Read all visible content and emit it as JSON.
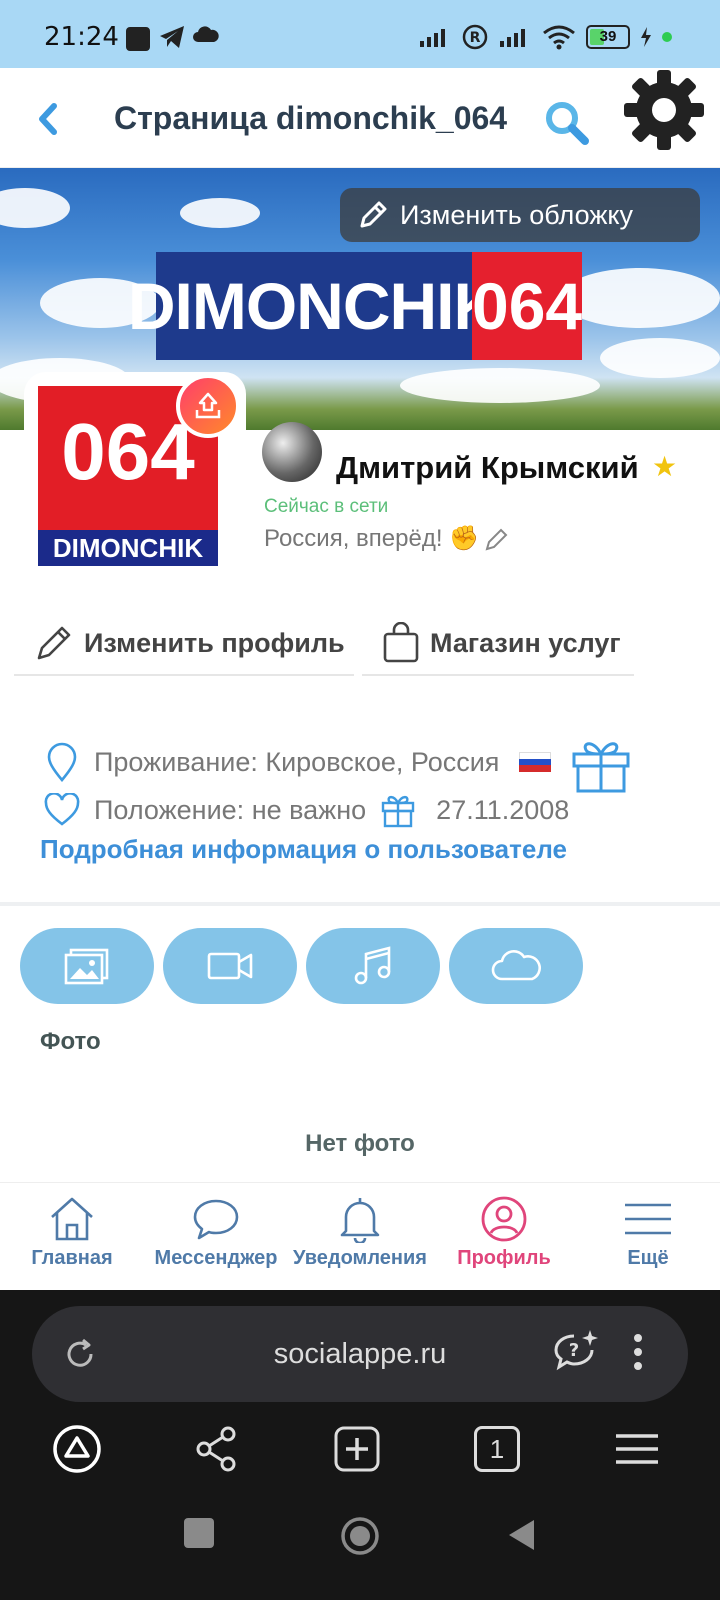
{
  "status_bar": {
    "time": "21:24",
    "battery_level": "39",
    "battery_fraction": 0.39
  },
  "header": {
    "title": "Страница dimonchik_064",
    "back_icon": "chevron-left-icon",
    "search_icon": "search-icon",
    "settings_icon": "gear-icon"
  },
  "cover": {
    "edit_label": "Изменить обложку",
    "banner_left": "DIMONCHIK",
    "banner_right": "064"
  },
  "avatar": {
    "number": "064",
    "label": "DIMONCHIK"
  },
  "user": {
    "name": "Дмитрий Крымский",
    "online": "Сейчас в сети",
    "status": "Россия, вперёд! ✊"
  },
  "actions": {
    "edit_profile": "Изменить профиль",
    "services_shop": "Магазин услуг"
  },
  "info": {
    "residence": "Проживание: Кировское, Россия",
    "position": "Положение: не важно",
    "birthdate": "27.11.2008",
    "more_link": "Подробная информация о пользователе"
  },
  "media": {
    "tabs": [
      "photos-icon",
      "video-icon",
      "music-icon",
      "cloud-icon"
    ],
    "section_label": "Фото",
    "empty_text": "Нет фото"
  },
  "bottom_nav": [
    {
      "label": "Главная",
      "icon": "home-icon"
    },
    {
      "label": "Мессенджер",
      "icon": "chat-icon"
    },
    {
      "label": "Уведомления",
      "icon": "bell-icon"
    },
    {
      "label": "Профиль",
      "icon": "profile-icon"
    },
    {
      "label": "Ещё",
      "icon": "menu-icon"
    }
  ],
  "browser": {
    "url": "socialappe.ru",
    "tab_count": "1"
  },
  "colors": {
    "status_bar": "#a9d8f5",
    "accent_blue": "#3d8fd8",
    "media_tab": "#84c4e8",
    "active_nav": "#e0457b",
    "online": "#5cbf7a"
  }
}
